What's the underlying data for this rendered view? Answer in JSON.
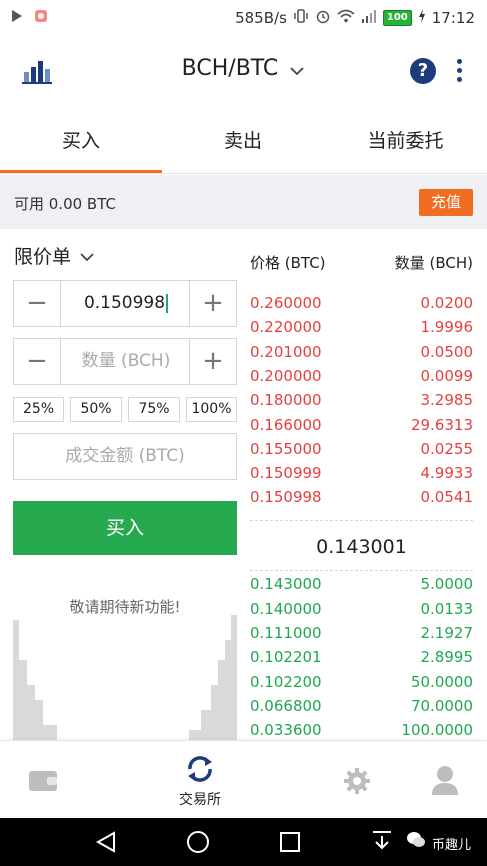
{
  "status_bar": {
    "speed": "585B/s",
    "battery": "100",
    "time": "17:12"
  },
  "header": {
    "pair": "BCH/BTC",
    "help": "?"
  },
  "tabs": [
    {
      "label": "买入",
      "active": true
    },
    {
      "label": "卖出",
      "active": false
    },
    {
      "label": "当前委托",
      "active": false
    }
  ],
  "available": {
    "text": "可用 0.00 BTC",
    "recharge_label": "充值"
  },
  "order_form": {
    "order_type": "限价单",
    "price_value": "0.150998",
    "quantity_placeholder": "数量 (BCH)",
    "percentages": [
      "25%",
      "50%",
      "75%",
      "100%"
    ],
    "amount_placeholder": "成交金额 (BTC)",
    "buy_label": "买入",
    "coming_soon": "敬请期待新功能!"
  },
  "order_book": {
    "price_header": "价格 (BTC)",
    "qty_header": "数量 (BCH)",
    "asks": [
      {
        "price": "0.260000",
        "qty": "0.0200"
      },
      {
        "price": "0.220000",
        "qty": "1.9996"
      },
      {
        "price": "0.201000",
        "qty": "0.0500"
      },
      {
        "price": "0.200000",
        "qty": "0.0099"
      },
      {
        "price": "0.180000",
        "qty": "3.2985"
      },
      {
        "price": "0.166000",
        "qty": "29.6313"
      },
      {
        "price": "0.155000",
        "qty": "0.0255"
      },
      {
        "price": "0.150999",
        "qty": "4.9933"
      },
      {
        "price": "0.150998",
        "qty": "0.0541"
      }
    ],
    "last_price": "0.143001",
    "bids": [
      {
        "price": "0.143000",
        "qty": "5.0000"
      },
      {
        "price": "0.140000",
        "qty": "0.0133"
      },
      {
        "price": "0.111000",
        "qty": "2.1927"
      },
      {
        "price": "0.102201",
        "qty": "2.8995"
      },
      {
        "price": "0.102200",
        "qty": "50.0000"
      },
      {
        "price": "0.066800",
        "qty": "70.0000"
      },
      {
        "price": "0.033600",
        "qty": "100.0000"
      }
    ]
  },
  "bottom_nav": {
    "exchange_label": "交易所"
  },
  "watermark": "币趣儿",
  "colors": {
    "accent": "#f26d21",
    "buy_green": "#27a94f",
    "ask_red": "#e53f3f",
    "bid_green": "#20a752",
    "brand_navy": "#1f3c7a"
  }
}
